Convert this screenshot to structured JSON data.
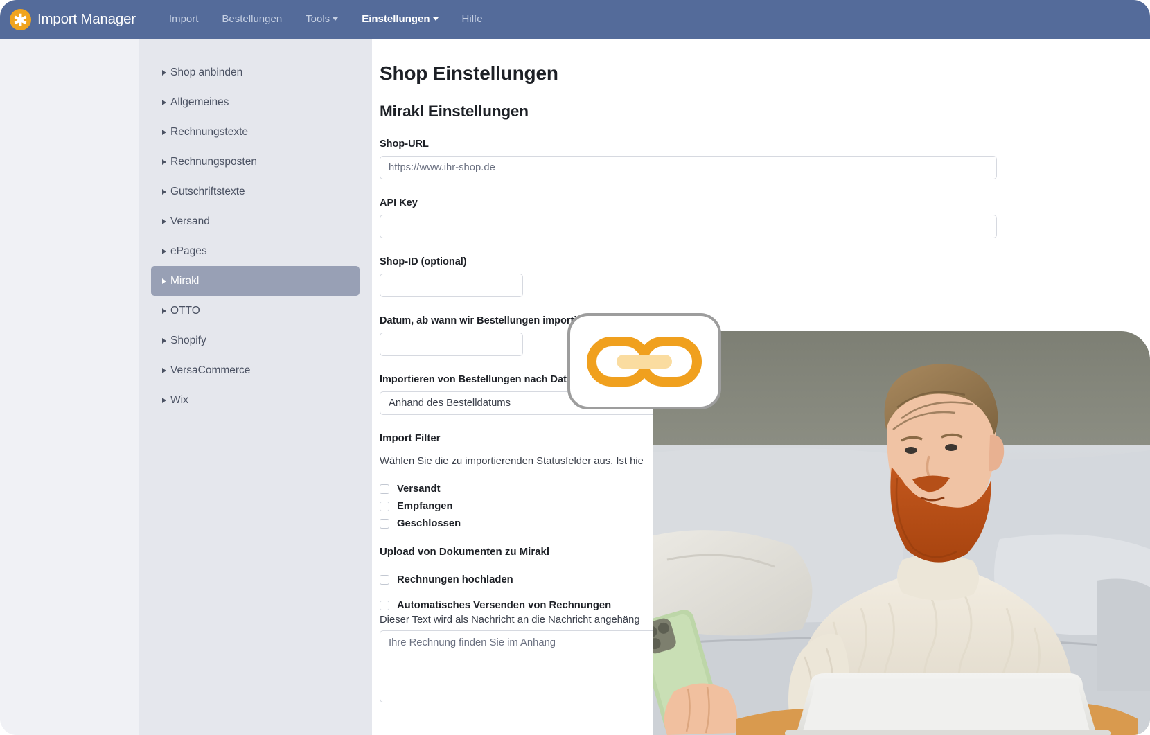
{
  "navbar": {
    "brand": "Import Manager",
    "brand_icon": "asterisk-star-icon",
    "brand_color": "#f0a41e",
    "bg_color": "#546b9a",
    "links": [
      {
        "label": "Import",
        "active": false,
        "has_caret": false
      },
      {
        "label": "Bestellungen",
        "active": false,
        "has_caret": false
      },
      {
        "label": "Tools",
        "active": false,
        "has_caret": true
      },
      {
        "label": "Einstellungen",
        "active": true,
        "has_caret": true
      },
      {
        "label": "Hilfe",
        "active": false,
        "has_caret": false
      }
    ]
  },
  "sidebar": {
    "bg_color": "#e5e7ed",
    "active_color": "#98a0b5",
    "items": [
      {
        "label": "Shop anbinden",
        "active": false
      },
      {
        "label": "Allgemeines",
        "active": false
      },
      {
        "label": "Rechnungstexte",
        "active": false
      },
      {
        "label": "Rechnungsposten",
        "active": false
      },
      {
        "label": "Gutschriftstexte",
        "active": false
      },
      {
        "label": "Versand",
        "active": false
      },
      {
        "label": "ePages",
        "active": false
      },
      {
        "label": "Mirakl",
        "active": true
      },
      {
        "label": "OTTO",
        "active": false
      },
      {
        "label": "Shopify",
        "active": false
      },
      {
        "label": "VersaCommerce",
        "active": false
      },
      {
        "label": "Wix",
        "active": false
      }
    ]
  },
  "main": {
    "page_title": "Shop Einstellungen",
    "section_title": "Mirakl Einstellungen",
    "fields": {
      "shop_url": {
        "label": "Shop-URL",
        "value": "",
        "placeholder": "https://www.ihr-shop.de"
      },
      "api_key": {
        "label": "API Key",
        "value": "",
        "placeholder": ""
      },
      "shop_id": {
        "label": "Shop-ID (optional)",
        "value": "",
        "placeholder": ""
      },
      "import_date": {
        "label": "Datum, ab wann wir Bestellungen importieren sollen",
        "value": "",
        "placeholder": ""
      },
      "import_by_date": {
        "label": "Importieren von Bestellungen nach Datum",
        "selected": "Anhand des Bestelldatums"
      }
    },
    "import_filter": {
      "heading": "Import Filter",
      "description": "Wählen Sie die zu importierenden Statusfelder aus. Ist hie",
      "checkboxes": [
        {
          "label": "Versandt",
          "checked": false
        },
        {
          "label": "Empfangen",
          "checked": false
        },
        {
          "label": "Geschlossen",
          "checked": false
        }
      ]
    },
    "upload_section": {
      "heading": "Upload von Dokumenten zu Mirakl",
      "checkboxes": [
        {
          "label": "Rechnungen hochladen",
          "checked": false
        },
        {
          "label": "Automatisches Versenden von Rechnungen",
          "checked": false
        }
      ],
      "message_hint": "Dieser Text wird als Nachricht an die Nachricht angehäng",
      "message_placeholder": "Ihre Rechnung finden Sie im Anhang",
      "message_value": ""
    }
  },
  "overlay": {
    "link_badge": {
      "icon": "chain-link-icon",
      "icon_color": "#f0a01e",
      "icon_accent_color": "#fadca0",
      "border_color": "#9d9d9d"
    },
    "photo": {
      "alt": "bearded-man-with-laptop-and-phone-on-couch"
    }
  }
}
